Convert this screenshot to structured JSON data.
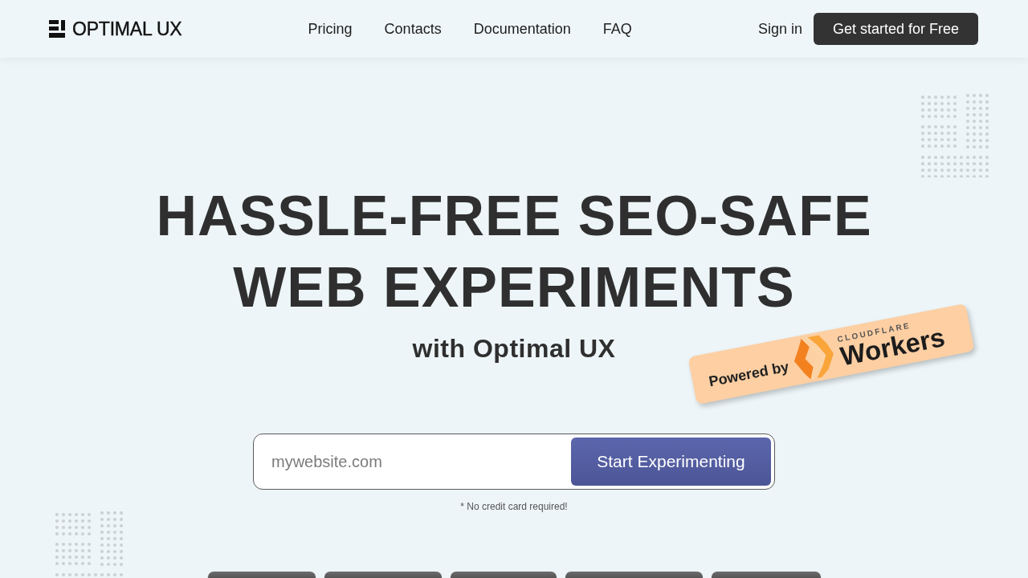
{
  "header": {
    "logo": "OPTIMAL UX",
    "nav": [
      "Pricing",
      "Contacts",
      "Documentation",
      "FAQ"
    ],
    "sign_in": "Sign in",
    "cta": "Get started for Free"
  },
  "hero": {
    "title_lines": [
      "HASSLE-FREE SEO-SAFE",
      "WEB EXPERIMENTS"
    ],
    "subtitle": "with Optimal UX"
  },
  "badge": {
    "prefix": "Powered by",
    "brand": "CLOUDFLARE",
    "product": "Workers"
  },
  "signup": {
    "placeholder": "mywebsite.com",
    "button": "Start Experimenting",
    "note": "* No credit card required!"
  }
}
